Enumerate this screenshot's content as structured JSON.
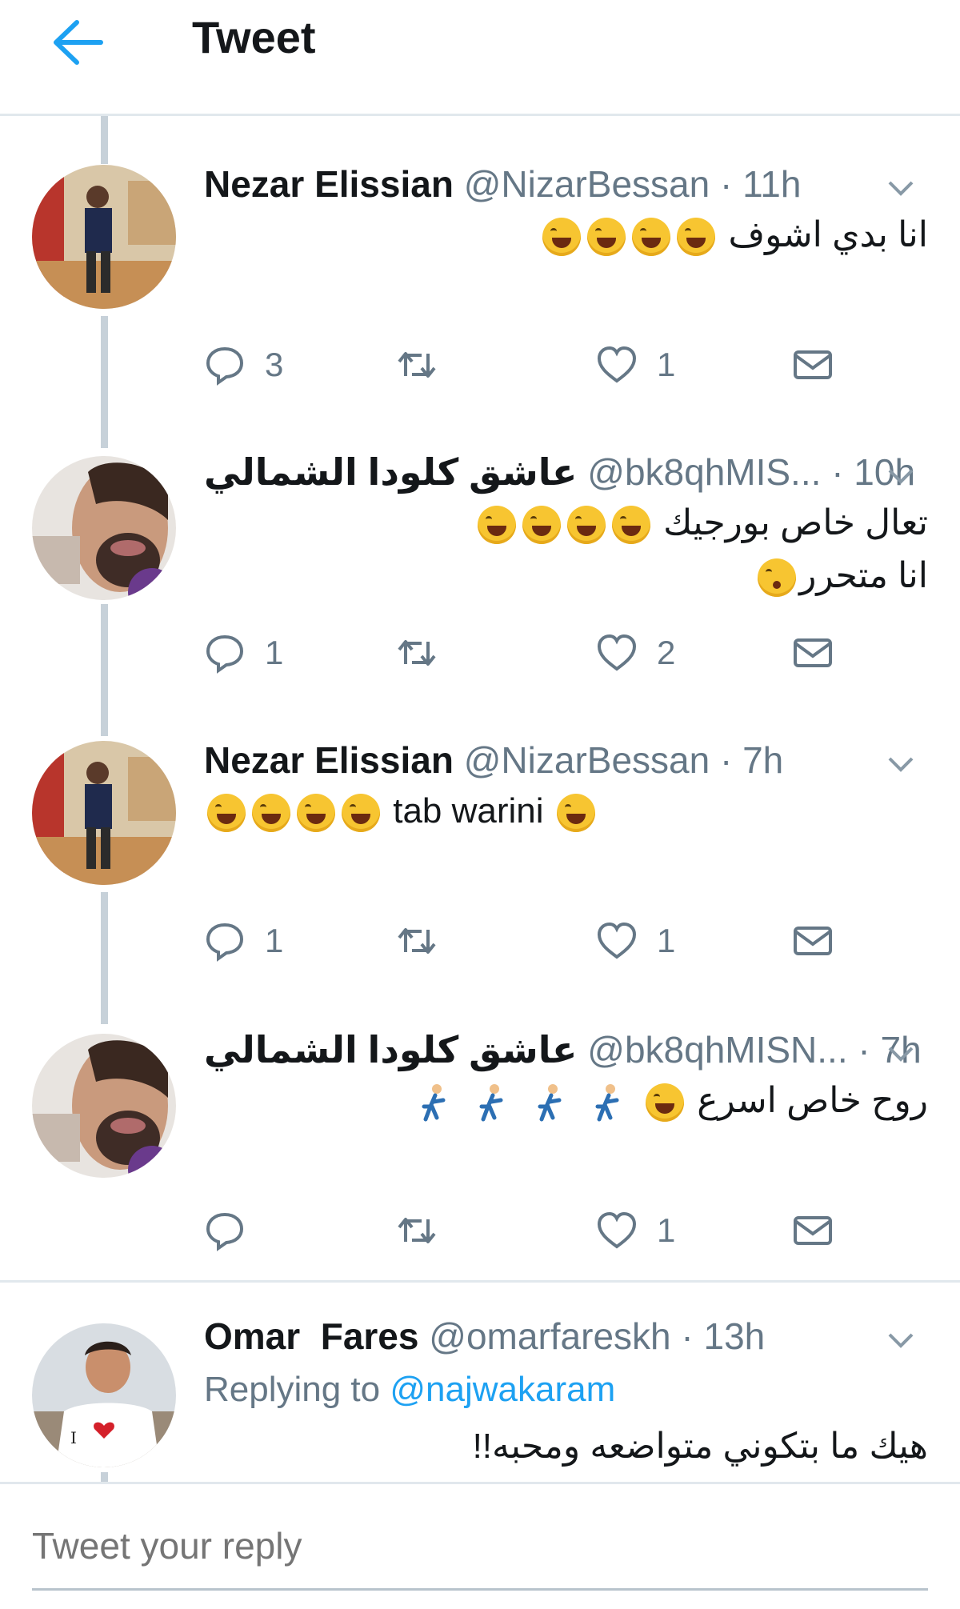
{
  "header": {
    "title": "Tweet"
  },
  "tweets": [
    {
      "name": "Nezar Elissian",
      "handle": "@NizarBessan",
      "time": "· 11h",
      "lines": [
        "انا بدي اشوف"
      ],
      "reply_count": "3",
      "retweet_count": "",
      "like_count": "1"
    },
    {
      "name": "عاشق كلودا الشمالي",
      "handle": "@bk8qhMIS...",
      "time": "· 10h",
      "lines": [
        "تعال خاص بورجيك",
        "انا متحرر"
      ],
      "reply_count": "1",
      "retweet_count": "",
      "like_count": "2"
    },
    {
      "name": "Nezar Elissian",
      "handle": "@NizarBessan",
      "time": "· 7h",
      "lines": [
        "tab warini"
      ],
      "reply_count": "1",
      "retweet_count": "",
      "like_count": "1"
    },
    {
      "name": "عاشق كلودا الشمالي",
      "handle": "@bk8qhMISN...",
      "time": "· 7h",
      "lines": [
        "روح خاص اسرع"
      ],
      "reply_count": "",
      "retweet_count": "",
      "like_count": "1"
    },
    {
      "name": "Omar  Fares",
      "handle": "@omarfareskh",
      "time": "· 13h",
      "replying_prefix": "Replying to",
      "replying_mention": "@najwakaram",
      "lines": [
        "هيك ما بتكوني متواضعه ومحبه!!"
      ]
    }
  ],
  "composer": {
    "placeholder": "Tweet your reply"
  },
  "colors": {
    "accent": "#1da1f2",
    "muted": "#657786",
    "divider": "#e1e8ed",
    "thread_line": "#c7d1d9"
  },
  "icons": [
    "back-arrow-icon",
    "chevron-down-icon",
    "reply-icon",
    "retweet-icon",
    "heart-icon",
    "mail-icon",
    "laughing-emoji-icon",
    "sleepy-emoji-icon",
    "runner-emoji-icon"
  ]
}
